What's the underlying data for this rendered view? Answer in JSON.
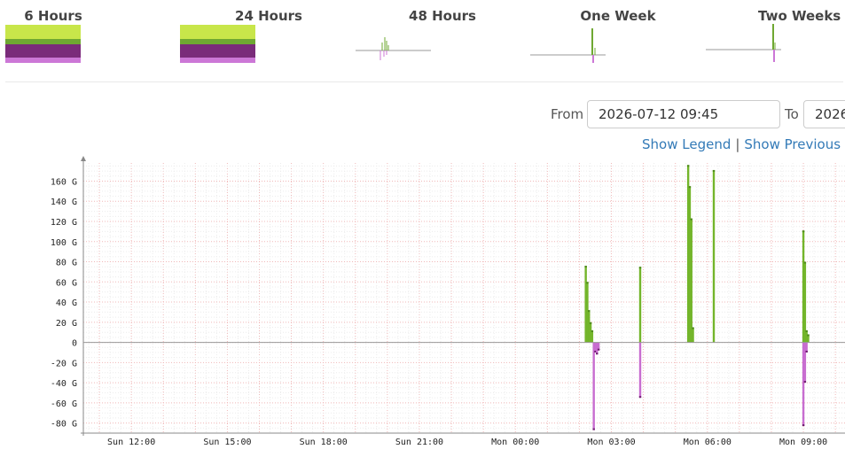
{
  "periods": [
    {
      "label": "6 Hours"
    },
    {
      "label": "24 Hours"
    },
    {
      "label": "48 Hours"
    },
    {
      "label": "One Week"
    },
    {
      "label": "Two Weeks"
    }
  ],
  "form": {
    "from_label": "From",
    "from_value": "2026-07-12 09:45",
    "to_label": "To",
    "to_value": "2026-"
  },
  "links": {
    "show_legend": "Show Legend",
    "separator": "|",
    "show_previous": "Show Previous"
  },
  "colors": {
    "inbound": "#73b52b",
    "inbound_dark": "#4e8a1c",
    "outbound": "#c86dd0",
    "outbound_dark": "#6e1d6e",
    "thumb_lime": "#c8e64a",
    "thumb_green": "#6fa832",
    "thumb_purple": "#7a2b7a",
    "thumb_pink": "#cc77d6"
  },
  "chart_data": {
    "type": "area",
    "title": "",
    "xlabel": "",
    "ylabel": "",
    "ylim": [
      -90,
      178
    ],
    "yticks": [
      "160 G",
      "140 G",
      "120 G",
      "100 G",
      "80 G",
      "60 G",
      "40 G",
      "20 G",
      "0",
      "-20 G",
      "-40 G",
      "-60 G",
      "-80 G"
    ],
    "ytick_values": [
      160,
      140,
      120,
      100,
      80,
      60,
      40,
      20,
      0,
      -20,
      -40,
      -60,
      -80
    ],
    "xlim_hours": [
      10.5,
      34.3
    ],
    "xticks": [
      "Sun 12:00",
      "Sun 15:00",
      "Sun 18:00",
      "Sun 21:00",
      "Mon 00:00",
      "Mon 03:00",
      "Mon 06:00",
      "Mon 09:00"
    ],
    "xtick_hours": [
      12,
      15,
      18,
      21,
      24,
      27,
      30,
      33
    ],
    "grid": true,
    "series": [
      {
        "points": [
          {
            "x": 26.2,
            "y": 76
          },
          {
            "x": 26.25,
            "y": 60
          },
          {
            "x": 26.3,
            "y": 32
          },
          {
            "x": 26.35,
            "y": 20
          },
          {
            "x": 26.4,
            "y": 12
          },
          {
            "x": 27.9,
            "y": 75
          },
          {
            "x": 29.4,
            "y": 176
          },
          {
            "x": 29.45,
            "y": 155
          },
          {
            "x": 29.5,
            "y": 123
          },
          {
            "x": 29.55,
            "y": 15
          },
          {
            "x": 30.2,
            "y": 171
          },
          {
            "x": 33.0,
            "y": 111
          },
          {
            "x": 33.05,
            "y": 80
          },
          {
            "x": 33.1,
            "y": 12
          },
          {
            "x": 33.15,
            "y": 8
          }
        ]
      },
      {
        "points": [
          {
            "x": 26.45,
            "y": -87
          },
          {
            "x": 26.5,
            "y": -10
          },
          {
            "x": 26.55,
            "y": -12
          },
          {
            "x": 26.6,
            "y": -8
          },
          {
            "x": 27.9,
            "y": -55
          },
          {
            "x": 33.0,
            "y": -83
          },
          {
            "x": 33.05,
            "y": -40
          },
          {
            "x": 33.1,
            "y": -10
          }
        ]
      }
    ]
  }
}
